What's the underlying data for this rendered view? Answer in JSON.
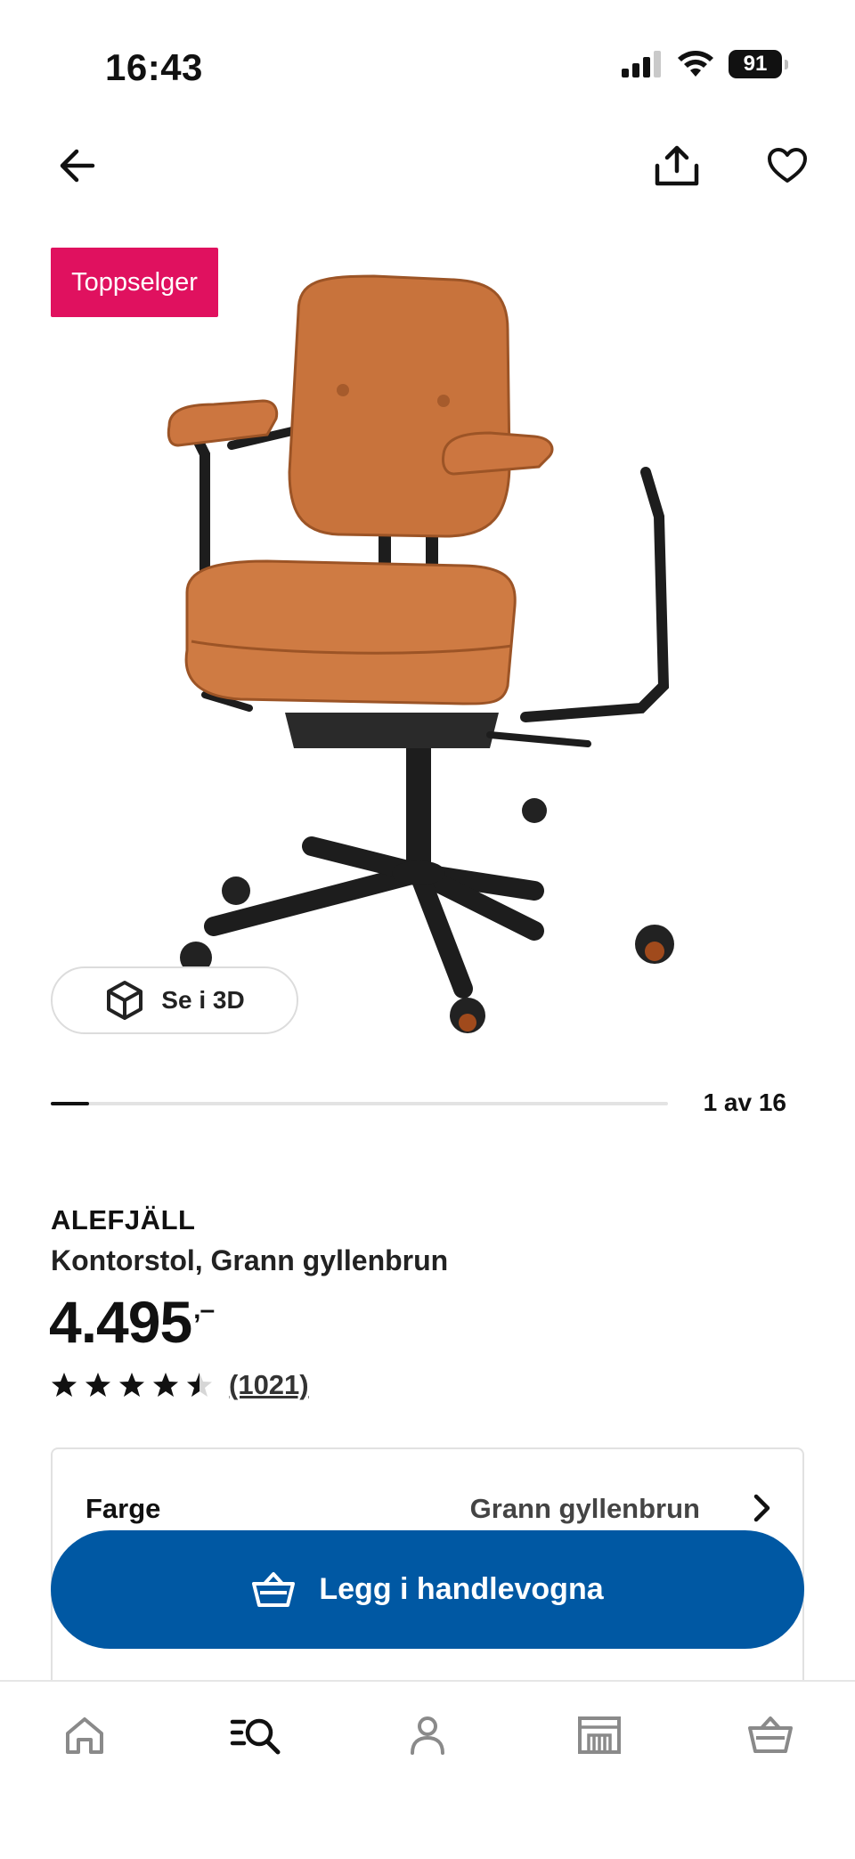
{
  "status_bar": {
    "time": "16:43",
    "battery": "91"
  },
  "product": {
    "badge": "Toppselger",
    "view_3d_label": "Se i 3D",
    "image_counter": "1 av 16",
    "image_progress": 0.0625,
    "brand": "ALEFJÄLL",
    "description": "Kontorstol, Grann gyllenbrun",
    "price": "4.495",
    "price_suffix": ",–",
    "rating": 4.5,
    "review_count": "(1021)"
  },
  "color_option": {
    "label": "Farge",
    "value": "Grann gyllenbrun"
  },
  "cta": {
    "label": "Legg i handlevogna"
  },
  "icons": {
    "back": "arrow-left-icon",
    "share": "share-icon",
    "favorite": "heart-icon",
    "view3d": "cube-icon",
    "cart_button": "basket-icon",
    "tabs": [
      "home-icon",
      "search-icon",
      "person-icon",
      "store-icon",
      "basket-icon"
    ]
  },
  "colors": {
    "badge": "#e0115f",
    "cta": "#0058a3",
    "leather": "#c8733c"
  }
}
